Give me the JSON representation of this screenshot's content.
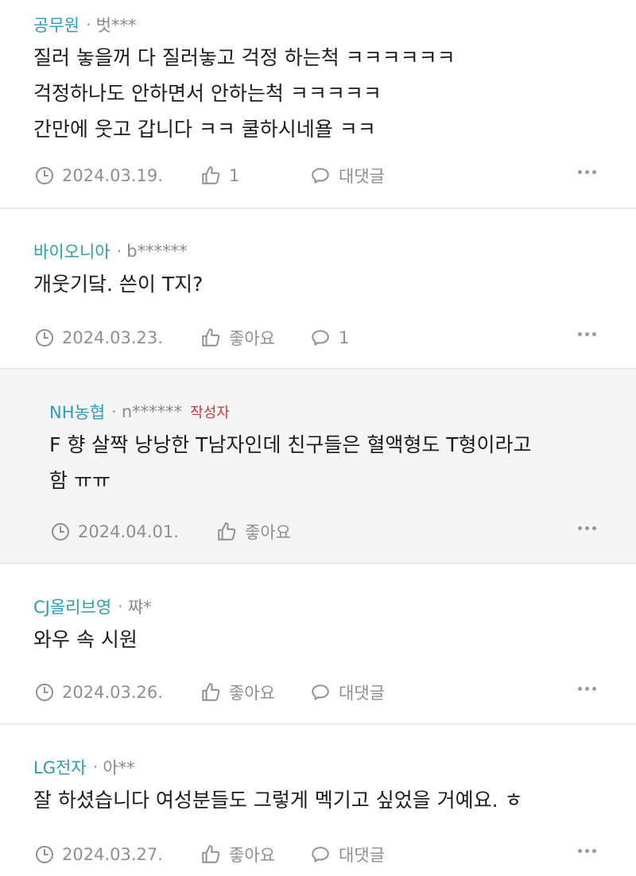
{
  "comments": [
    {
      "company": "공무원",
      "nickname": "벗***",
      "lines": [
        "질러 놓을꺼 다 질러놓고 걱정 하는척 ㅋㅋㅋㅋㅋㅋ",
        "걱정하나도 안하면서 안하는척 ㅋㅋㅋㅋㅋ",
        "간만에 웃고 갑니다 ㅋㅋ 쿨하시네욜 ㅋㅋ"
      ],
      "date": "2024.03.19.",
      "like": "1",
      "reply": "대댓글"
    },
    {
      "company": "바이오니아",
      "nickname": "b******",
      "lines": [
        "개웃기닼. 쓴이 T지?"
      ],
      "date": "2024.03.23.",
      "like": "좋아요",
      "reply": "1"
    },
    {
      "company": "NH농협",
      "nickname": "n******",
      "badge": "작성자",
      "lines": [
        "F 향 살짝 낭낭한 T남자인데 친구들은 혈액형도 T형이라고",
        "함 ㅠㅠ"
      ],
      "date": "2024.04.01.",
      "like": "좋아요"
    },
    {
      "company": "CJ올리브영",
      "nickname": "쨔*",
      "lines": [
        "와우 속 시원"
      ],
      "date": "2024.03.26.",
      "like": "좋아요",
      "reply": "대댓글"
    },
    {
      "company": "LG전자",
      "nickname": "아**",
      "lines": [
        "잘 하셨습니다 여성분들도 그렇게 멕기고 싶었을 거예요. ㅎ"
      ],
      "date": "2024.03.27.",
      "like": "좋아요",
      "reply": "대댓글"
    }
  ],
  "icons": {
    "clock": "clock-icon",
    "like": "thumbs-up-icon",
    "reply": "speech-bubble-icon",
    "more": "more-dots-icon"
  },
  "colors": {
    "company": "#2f9bb5",
    "author_badge": "#c73a3a",
    "meta_gray": "#8f8f8f",
    "reply_bg": "#f5f5f5"
  }
}
